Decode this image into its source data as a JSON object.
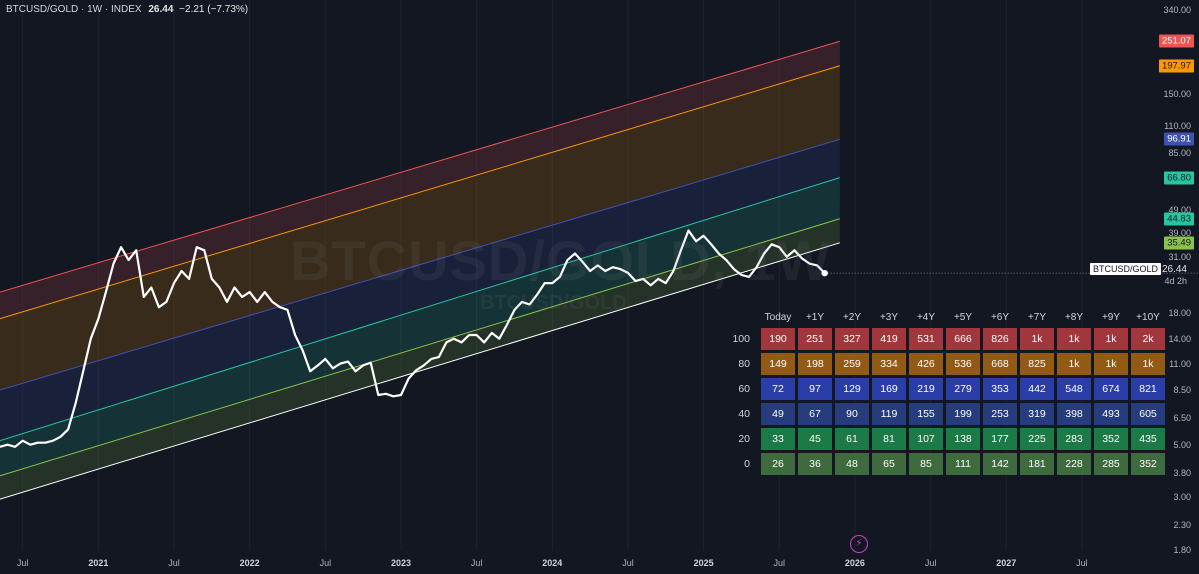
{
  "header": {
    "symbol": "BTCUSD/GOLD · 1W · INDEX",
    "price": "26.44",
    "change": "−2.21 (−7.73%)"
  },
  "watermark": {
    "main": "BTCUSD/GOLD, 1W",
    "sub": "BTCUSD/GOLD"
  },
  "current": {
    "label": "BTCUSD/GOLD",
    "price": "26.44",
    "countdown": "4d 2h"
  },
  "colors": {
    "background": "#131722",
    "band_100": "#f05350",
    "band_80": "#ff9800",
    "band_60": "#3f51b5",
    "band_40": "#26c6a1",
    "band_20": "#8bc34a",
    "cell_100": "#a1373c",
    "cell_80": "#935a16",
    "cell_60": "#2b3ea8",
    "cell_40": "#263c7c",
    "cell_20": "#1b7a45",
    "cell_0": "#3d6b3d"
  },
  "chart_data": {
    "type": "line",
    "scale": "log",
    "ylim": [
      1.8,
      340
    ],
    "xlim": [
      2020.35,
      2027.95
    ],
    "y_ticks": [
      {
        "v": 340,
        "label": "340.00"
      },
      {
        "v": 150,
        "label": "150.00"
      },
      {
        "v": 110,
        "label": "110.00"
      },
      {
        "v": 85,
        "label": "85.00"
      },
      {
        "v": 49,
        "label": "49.00"
      },
      {
        "v": 39,
        "label": "39.00"
      },
      {
        "v": 31,
        "label": "31.00"
      },
      {
        "v": 18,
        "label": "18.00"
      },
      {
        "v": 14,
        "label": "14.00"
      },
      {
        "v": 11,
        "label": "11.00"
      },
      {
        "v": 8.5,
        "label": "8.50"
      },
      {
        "v": 6.5,
        "label": "6.50"
      },
      {
        "v": 5,
        "label": "5.00"
      },
      {
        "v": 3.8,
        "label": "3.80"
      },
      {
        "v": 3,
        "label": "3.00"
      },
      {
        "v": 2.3,
        "label": "2.30"
      },
      {
        "v": 1.8,
        "label": "1.80"
      }
    ],
    "x_ticks": [
      {
        "t": 2020.5,
        "label": "Jul",
        "year": false
      },
      {
        "t": 2021.0,
        "label": "2021",
        "year": true
      },
      {
        "t": 2021.5,
        "label": "Jul",
        "year": false
      },
      {
        "t": 2022.0,
        "label": "2022",
        "year": true
      },
      {
        "t": 2022.5,
        "label": "Jul",
        "year": false
      },
      {
        "t": 2023.0,
        "label": "2023",
        "year": true
      },
      {
        "t": 2023.5,
        "label": "Jul",
        "year": false
      },
      {
        "t": 2024.0,
        "label": "2024",
        "year": true
      },
      {
        "t": 2024.5,
        "label": "Jul",
        "year": false
      },
      {
        "t": 2025.0,
        "label": "2025",
        "year": true
      },
      {
        "t": 2025.5,
        "label": "Jul",
        "year": false
      },
      {
        "t": 2026.0,
        "label": "2026",
        "year": true
      },
      {
        "t": 2026.5,
        "label": "Jul",
        "year": false
      },
      {
        "t": 2027.0,
        "label": "2027",
        "year": true
      },
      {
        "t": 2027.5,
        "label": "Jul",
        "year": false
      }
    ],
    "band_end_labels": [
      {
        "v": 251.07,
        "label": "251.07",
        "band": "100"
      },
      {
        "v": 197.97,
        "label": "197.97",
        "band": "80"
      },
      {
        "v": 96.91,
        "label": "96.91",
        "band": "60"
      },
      {
        "v": 66.8,
        "label": "66.80",
        "band": "40"
      },
      {
        "v": 44.83,
        "label": "44.83",
        "band": "20"
      },
      {
        "v": 35.49,
        "label": "35.49",
        "band": "0"
      }
    ],
    "bands": [
      {
        "name": "100",
        "start": [
          2020.35,
          22
        ],
        "end": [
          2025.9,
          251.07
        ]
      },
      {
        "name": "80",
        "start": [
          2020.35,
          17
        ],
        "end": [
          2025.9,
          197.97
        ]
      },
      {
        "name": "60",
        "start": [
          2020.35,
          8.5
        ],
        "end": [
          2025.9,
          96.91
        ]
      },
      {
        "name": "40",
        "start": [
          2020.35,
          5.2
        ],
        "end": [
          2025.9,
          66.8
        ]
      },
      {
        "name": "20",
        "start": [
          2020.35,
          3.7
        ],
        "end": [
          2025.9,
          44.83
        ]
      },
      {
        "name": "0",
        "start": [
          2020.35,
          2.95
        ],
        "end": [
          2025.9,
          35.49
        ]
      }
    ],
    "series": [
      {
        "x": [
          2020.35,
          2020.4,
          2020.45,
          2020.5,
          2020.55,
          2020.6,
          2020.65,
          2020.7,
          2020.75,
          2020.8,
          2020.85,
          2020.9,
          2020.95,
          2021.0,
          2021.05,
          2021.1,
          2021.15,
          2021.2,
          2021.25,
          2021.3,
          2021.35,
          2021.4,
          2021.45,
          2021.5,
          2021.55,
          2021.6,
          2021.65,
          2021.7,
          2021.75,
          2021.8,
          2021.85,
          2021.9,
          2021.95,
          2022.0,
          2022.05,
          2022.1,
          2022.15,
          2022.2,
          2022.25,
          2022.3,
          2022.35,
          2022.4,
          2022.45,
          2022.5,
          2022.55,
          2022.6,
          2022.65,
          2022.7,
          2022.75,
          2022.8,
          2022.85,
          2022.9,
          2022.95,
          2023.0,
          2023.05,
          2023.1,
          2023.15,
          2023.2,
          2023.25,
          2023.3,
          2023.35,
          2023.4,
          2023.45,
          2023.5,
          2023.55,
          2023.6,
          2023.65,
          2023.7,
          2023.75,
          2023.8,
          2023.85,
          2023.9,
          2023.95,
          2024.0,
          2024.05,
          2024.1,
          2024.15,
          2024.2,
          2024.25,
          2024.3,
          2024.35,
          2024.4,
          2024.45,
          2024.5,
          2024.55,
          2024.6,
          2024.65,
          2024.7,
          2024.75,
          2024.8,
          2024.85,
          2024.9,
          2024.95,
          2025.0,
          2025.05,
          2025.1,
          2025.15,
          2025.2,
          2025.25,
          2025.3,
          2025.35,
          2025.4,
          2025.45,
          2025.5,
          2025.55,
          2025.6,
          2025.65,
          2025.7,
          2025.75,
          2025.8
        ],
        "y": [
          4.9,
          5.0,
          4.9,
          5.2,
          5.0,
          5.1,
          5.1,
          5.2,
          5.4,
          5.8,
          7.5,
          10.2,
          14,
          17,
          22,
          29,
          34,
          30,
          33,
          21,
          23,
          19,
          20,
          24,
          27,
          25,
          34,
          33,
          25,
          23,
          20,
          23,
          21,
          22,
          20,
          22,
          20,
          19,
          18.5,
          14.5,
          12.5,
          10.2,
          10.8,
          11.5,
          10.5,
          11.0,
          11.2,
          10.2,
          10.8,
          11.1,
          8.1,
          8.2,
          8.0,
          8.1,
          9.5,
          10.3,
          10.8,
          11.5,
          11.7,
          13.5,
          14.0,
          13.5,
          14.5,
          14.5,
          13.5,
          14.8,
          14.0,
          16.0,
          18.5,
          20.0,
          19.5,
          21.5,
          24.0,
          24.0,
          25.5,
          30.0,
          32.0,
          29.5,
          27.0,
          28.5,
          27.0,
          28.0,
          27.5,
          26.5,
          24.5,
          25.0,
          23.5,
          25.0,
          24.0,
          27.0,
          33.0,
          40.0,
          36.0,
          38.0,
          35.0,
          32.0,
          30.0,
          27.5,
          26.0,
          25.5,
          28.0,
          32.0,
          35.0,
          34.0,
          31.0,
          33.0,
          30.5,
          29.0,
          28.5,
          26.44
        ]
      }
    ]
  },
  "projection_table": {
    "headers": [
      "Today",
      "+1Y",
      "+2Y",
      "+3Y",
      "+4Y",
      "+5Y",
      "+6Y",
      "+7Y",
      "+8Y",
      "+9Y",
      "+10Y"
    ],
    "rows": [
      {
        "label": "100",
        "band": "100",
        "cells": [
          "190",
          "251",
          "327",
          "419",
          "531",
          "666",
          "826",
          "1k",
          "1k",
          "1k",
          "2k"
        ]
      },
      {
        "label": "80",
        "band": "80",
        "cells": [
          "149",
          "198",
          "259",
          "334",
          "426",
          "536",
          "668",
          "825",
          "1k",
          "1k",
          "1k"
        ]
      },
      {
        "label": "60",
        "band": "60",
        "cells": [
          "72",
          "97",
          "129",
          "169",
          "219",
          "279",
          "353",
          "442",
          "548",
          "674",
          "821"
        ]
      },
      {
        "label": "40",
        "band": "40",
        "cells": [
          "49",
          "67",
          "90",
          "119",
          "155",
          "199",
          "253",
          "319",
          "398",
          "493",
          "605"
        ]
      },
      {
        "label": "20",
        "band": "20",
        "cells": [
          "33",
          "45",
          "61",
          "81",
          "107",
          "138",
          "177",
          "225",
          "283",
          "352",
          "435"
        ]
      },
      {
        "label": "0",
        "band": "0",
        "cells": [
          "26",
          "36",
          "48",
          "65",
          "85",
          "111",
          "142",
          "181",
          "228",
          "285",
          "352"
        ]
      }
    ]
  }
}
